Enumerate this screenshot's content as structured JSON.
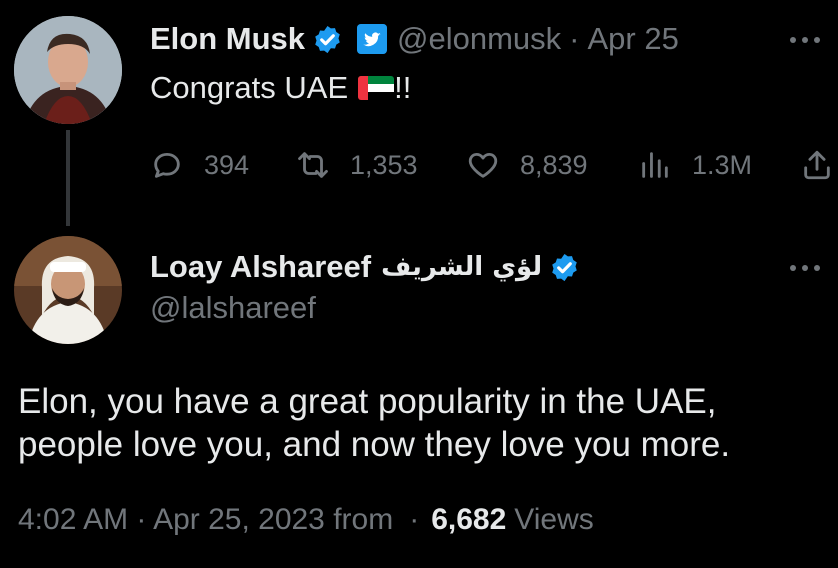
{
  "tweet": {
    "author": {
      "name": "Elon Musk",
      "handle": "@elonmusk",
      "verified_icon": "verified-badge-icon",
      "platform_icon": "twitter-bird-icon"
    },
    "separator": "·",
    "date": "Apr 25",
    "text": "Congrats UAE",
    "text_suffix": "!!",
    "flag": "uae-flag-icon",
    "actions": {
      "replies": "394",
      "retweets": "1,353",
      "likes": "8,839",
      "views": "1.3M"
    }
  },
  "reply": {
    "author": {
      "name": "Loay Alshareef",
      "name_arabic": "لؤي الشريف",
      "handle": "@lalshareef",
      "verified_icon": "verified-badge-icon"
    },
    "text_line1": "Elon, you have a great popularity in the UAE,",
    "text_line2": "people love you, and now they love you more.",
    "footer": {
      "time_date": "4:02 AM · Apr 25, 2023 from",
      "separator": "·",
      "views_count": "6,682",
      "views_label": "Views"
    }
  },
  "colors": {
    "background": "#000000",
    "text": "#e7e9ea",
    "muted": "#71767b",
    "verified": "#1d9bf0"
  }
}
